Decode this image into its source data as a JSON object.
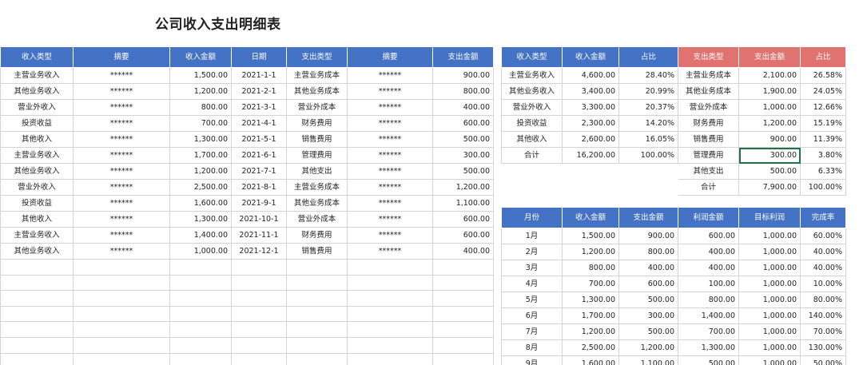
{
  "title": "公司收入支出明细表",
  "main_table": {
    "headers": [
      "收入类型",
      "摘要",
      "收入金额",
      "日期",
      "支出类型",
      "摘要",
      "支出金额"
    ],
    "rows": [
      [
        "主营业务收入",
        "******",
        "1,500.00",
        "2021-1-1",
        "主营业务成本",
        "******",
        "900.00"
      ],
      [
        "其他业务收入",
        "******",
        "1,200.00",
        "2021-2-1",
        "其他业务成本",
        "******",
        "800.00"
      ],
      [
        "营业外收入",
        "******",
        "800.00",
        "2021-3-1",
        "营业外成本",
        "******",
        "400.00"
      ],
      [
        "投资收益",
        "******",
        "700.00",
        "2021-4-1",
        "财务费用",
        "******",
        "600.00"
      ],
      [
        "其他收入",
        "******",
        "1,300.00",
        "2021-5-1",
        "销售费用",
        "******",
        "500.00"
      ],
      [
        "主营业务收入",
        "******",
        "1,700.00",
        "2021-6-1",
        "管理费用",
        "******",
        "300.00"
      ],
      [
        "其他业务收入",
        "******",
        "1,200.00",
        "2021-7-1",
        "其他支出",
        "******",
        "500.00"
      ],
      [
        "营业外收入",
        "******",
        "2,500.00",
        "2021-8-1",
        "主营业务成本",
        "******",
        "1,200.00"
      ],
      [
        "投资收益",
        "******",
        "1,600.00",
        "2021-9-1",
        "其他业务成本",
        "******",
        "1,100.00"
      ],
      [
        "其他收入",
        "******",
        "1,300.00",
        "2021-10-1",
        "营业外成本",
        "******",
        "600.00"
      ],
      [
        "主营业务收入",
        "******",
        "1,400.00",
        "2021-11-1",
        "财务费用",
        "******",
        "600.00"
      ],
      [
        "其他业务收入",
        "******",
        "1,000.00",
        "2021-12-1",
        "销售费用",
        "******",
        "400.00"
      ],
      [
        "",
        "",
        "",
        "",
        "",
        "",
        ""
      ],
      [
        "",
        "",
        "",
        "",
        "",
        "",
        ""
      ],
      [
        "",
        "",
        "",
        "",
        "",
        "",
        ""
      ],
      [
        "",
        "",
        "",
        "",
        "",
        "",
        ""
      ],
      [
        "",
        "",
        "",
        "",
        "",
        "",
        ""
      ],
      [
        "",
        "",
        "",
        "",
        "",
        "",
        ""
      ],
      [
        "",
        "",
        "",
        "",
        "",
        "",
        ""
      ]
    ]
  },
  "summary_table": {
    "headers": [
      "收入类型",
      "收入金额",
      "占比",
      "支出类型",
      "支出金额",
      "占比"
    ],
    "rows": [
      [
        "主营业务收入",
        "4,600.00",
        "28.40%",
        "主营业务成本",
        "2,100.00",
        "26.58%"
      ],
      [
        "其他业务收入",
        "3,400.00",
        "20.99%",
        "其他业务成本",
        "1,900.00",
        "24.05%"
      ],
      [
        "营业外收入",
        "3,300.00",
        "20.37%",
        "营业外成本",
        "1,000.00",
        "12.66%"
      ],
      [
        "投资收益",
        "2,300.00",
        "14.20%",
        "财务费用",
        "1,200.00",
        "15.19%"
      ],
      [
        "其他收入",
        "2,600.00",
        "16.05%",
        "销售费用",
        "900.00",
        "11.39%"
      ],
      [
        "合计",
        "16,200.00",
        "100.00%",
        "管理费用",
        "300.00",
        "3.80%"
      ],
      [
        "",
        "",
        "",
        "其他支出",
        "500.00",
        "6.33%"
      ],
      [
        "",
        "",
        "",
        "合计",
        "7,900.00",
        "100.00%"
      ]
    ]
  },
  "monthly_table": {
    "headers": [
      "月份",
      "收入金额",
      "支出金额",
      "利润金额",
      "目标利润",
      "完成率"
    ],
    "rows": [
      [
        "1月",
        "1,500.00",
        "900.00",
        "600.00",
        "1,000.00",
        "60.00%"
      ],
      [
        "2月",
        "1,200.00",
        "800.00",
        "400.00",
        "1,000.00",
        "40.00%"
      ],
      [
        "3月",
        "800.00",
        "400.00",
        "400.00",
        "1,000.00",
        "40.00%"
      ],
      [
        "4月",
        "700.00",
        "600.00",
        "100.00",
        "1,000.00",
        "10.00%"
      ],
      [
        "5月",
        "1,300.00",
        "500.00",
        "800.00",
        "1,000.00",
        "80.00%"
      ],
      [
        "6月",
        "1,700.00",
        "300.00",
        "1,400.00",
        "1,000.00",
        "140.00%"
      ],
      [
        "7月",
        "1,200.00",
        "500.00",
        "700.00",
        "1,000.00",
        "70.00%"
      ],
      [
        "8月",
        "2,500.00",
        "1,200.00",
        "1,300.00",
        "1,000.00",
        "130.00%"
      ],
      [
        "9月",
        "1,600.00",
        "1,100.00",
        "500.00",
        "1,000.00",
        "50.00%"
      ]
    ]
  },
  "colors": {
    "header_blue": "#4472c4",
    "header_red": "#e07370",
    "selection_green": "#217346",
    "grid": "#d4d4d4"
  }
}
